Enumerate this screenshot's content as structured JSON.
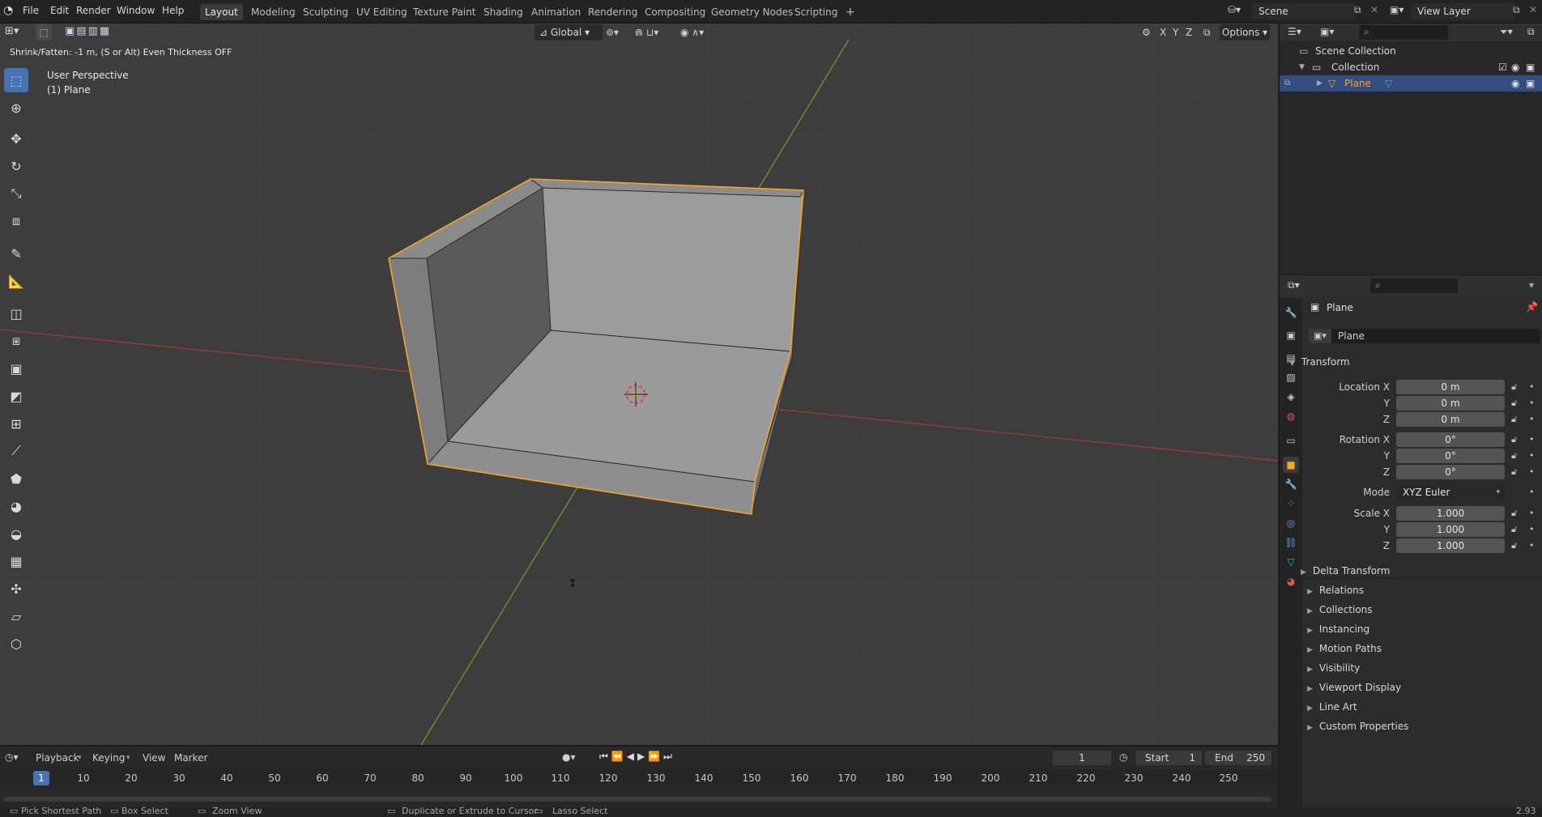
{
  "topbar": {
    "menus": [
      "File",
      "Edit",
      "Render",
      "Window",
      "Help"
    ],
    "workspaces": [
      "Layout",
      "Modeling",
      "Sculpting",
      "UV Editing",
      "Texture Paint",
      "Shading",
      "Animation",
      "Rendering",
      "Compositing",
      "Geometry Nodes",
      "Scripting"
    ],
    "active_workspace": "Layout",
    "add_tab": "+",
    "scene": "Scene",
    "view_layer": "View Layer"
  },
  "viewport": {
    "operator_hint": "Shrink/Fatten: -1 m, (S or Alt) Even Thickness OFF",
    "view_name": "User Perspective",
    "object_label": "(1) Plane",
    "orientation": "Global",
    "axes": [
      "X",
      "Y",
      "Z"
    ],
    "options": "Options"
  },
  "timeline": {
    "menus": [
      "Playback",
      "Keying",
      "View",
      "Marker"
    ],
    "current_frame": "1",
    "start_label": "Start",
    "start": "1",
    "end_label": "End",
    "end": "250",
    "ticks": [
      "1",
      "10",
      "20",
      "30",
      "40",
      "50",
      "60",
      "70",
      "80",
      "90",
      "100",
      "110",
      "120",
      "130",
      "140",
      "150",
      "160",
      "170",
      "180",
      "190",
      "200",
      "210",
      "220",
      "230",
      "240",
      "250"
    ]
  },
  "statusbar": {
    "items": [
      "Pick Shortest Path",
      "Box Select",
      "Zoom View",
      "Duplicate or Extrude to Cursor",
      "Lasso Select"
    ],
    "version": "2.93"
  },
  "outliner": {
    "scene_collection": "Scene Collection",
    "collection": "Collection",
    "object": "Plane"
  },
  "properties": {
    "object_name": "Plane",
    "data_name": "Plane",
    "transform_title": "Transform",
    "location_label": "Location X",
    "location": [
      "0 m",
      "0 m",
      "0 m"
    ],
    "rotation_label": "Rotation X",
    "rotation": [
      "0°",
      "0°",
      "0°"
    ],
    "mode_label": "Mode",
    "mode": "XYZ Euler",
    "scale_label": "Scale X",
    "scale": [
      "1.000",
      "1.000",
      "1.000"
    ],
    "axis_y": "Y",
    "axis_z": "Z",
    "delta_transform": "Delta Transform",
    "panels": [
      "Relations",
      "Collections",
      "Instancing",
      "Motion Paths",
      "Visibility",
      "Viewport Display",
      "Line Art",
      "Custom Properties"
    ]
  },
  "colors": {
    "accent": "#4772b3",
    "selection_outline": "#f5a623",
    "x_axis": "#b33b3b",
    "y_axis": "#6b9a2a"
  }
}
